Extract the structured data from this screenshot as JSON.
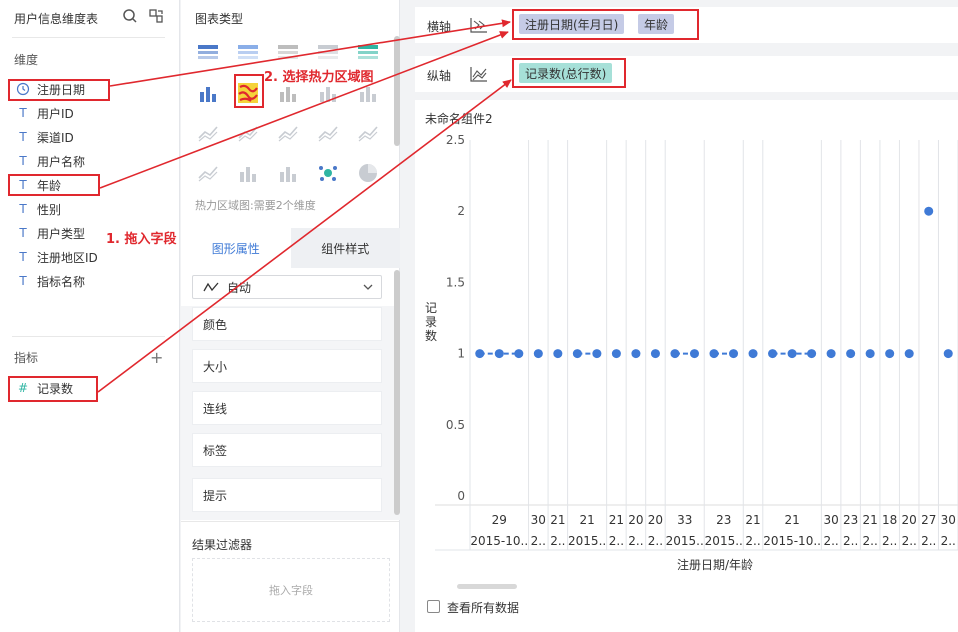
{
  "left": {
    "table_name": "用户信息维度表",
    "dim_section": "维度",
    "dimensions": [
      {
        "type": "time",
        "label": "注册日期"
      },
      {
        "type": "T",
        "label": "用户ID"
      },
      {
        "type": "T",
        "label": "渠道ID"
      },
      {
        "type": "T",
        "label": "用户名称"
      },
      {
        "type": "T",
        "label": "年龄"
      },
      {
        "type": "T",
        "label": "性别"
      },
      {
        "type": "T",
        "label": "用户类型"
      },
      {
        "type": "T",
        "label": "注册地区ID"
      },
      {
        "type": "T",
        "label": "指标名称"
      }
    ],
    "mea_section": "指标",
    "measures": [
      {
        "type": "#",
        "label": "记录数"
      }
    ],
    "plus": "+"
  },
  "mid": {
    "title": "图表类型",
    "hint": "热力区域图:需要2个维度",
    "tab_active": "图形属性",
    "tab_inactive": "组件样式",
    "select_value": "自动",
    "props": [
      "颜色",
      "大小",
      "连线",
      "标签",
      "提示"
    ],
    "filter_title": "结果过滤器",
    "filter_placeholder": "拖入字段"
  },
  "right": {
    "x_axis_label": "横轴",
    "y_axis_label": "纵轴",
    "x_pills": [
      "注册日期(年月日)",
      "年龄"
    ],
    "y_pills": [
      "记录数(总行数)"
    ],
    "check_label": "查看所有数据"
  },
  "annotations": {
    "step1": "1. 拖入字段",
    "step2": "2. 选择热力区域图"
  },
  "colors": {
    "accent": "#3f7ad6",
    "annotation": "#e0282e",
    "dot": "#3f7ad6"
  },
  "chart_data": {
    "type": "scatter",
    "title": "未命名组件2",
    "ylabel": "记录数",
    "xlabel": "注册日期/年龄",
    "ylim": [
      0,
      2.5
    ],
    "yticks": [
      "2.5",
      "2",
      "1.5",
      "1",
      "0.5",
      "0"
    ],
    "groups": [
      {
        "age": "29",
        "date": "2015-10..",
        "cols": 3,
        "values": [
          1,
          1,
          1
        ]
      },
      {
        "age": "30",
        "date": "2..",
        "cols": 1,
        "values": [
          1
        ]
      },
      {
        "age": "21",
        "date": "2..",
        "cols": 1,
        "values": [
          1
        ]
      },
      {
        "age": "21",
        "date": "2015..",
        "cols": 2,
        "values": [
          1,
          1
        ]
      },
      {
        "age": "21",
        "date": "2..",
        "cols": 1,
        "values": [
          1
        ]
      },
      {
        "age": "20",
        "date": "2..",
        "cols": 1,
        "values": [
          1
        ]
      },
      {
        "age": "20",
        "date": "2..",
        "cols": 1,
        "values": [
          1
        ]
      },
      {
        "age": "33",
        "date": "2015..",
        "cols": 2,
        "values": [
          1,
          1
        ]
      },
      {
        "age": "23",
        "date": "2015..",
        "cols": 2,
        "values": [
          1,
          1
        ]
      },
      {
        "age": "21",
        "date": "2..",
        "cols": 1,
        "values": [
          1
        ]
      },
      {
        "age": "21",
        "date": "2015-10..",
        "cols": 3,
        "values": [
          1,
          1,
          1
        ]
      },
      {
        "age": "30",
        "date": "2..",
        "cols": 1,
        "values": [
          1
        ]
      },
      {
        "age": "23",
        "date": "2..",
        "cols": 1,
        "values": [
          1
        ]
      },
      {
        "age": "21",
        "date": "2..",
        "cols": 1,
        "values": [
          1
        ]
      },
      {
        "age": "18",
        "date": "2..",
        "cols": 1,
        "values": [
          1
        ]
      },
      {
        "age": "20",
        "date": "2..",
        "cols": 1,
        "values": [
          1
        ]
      },
      {
        "age": "27",
        "date": "2..",
        "cols": 1,
        "values": [
          2
        ]
      },
      {
        "age": "30",
        "date": "2..",
        "cols": 1,
        "values": [
          1
        ]
      }
    ]
  }
}
